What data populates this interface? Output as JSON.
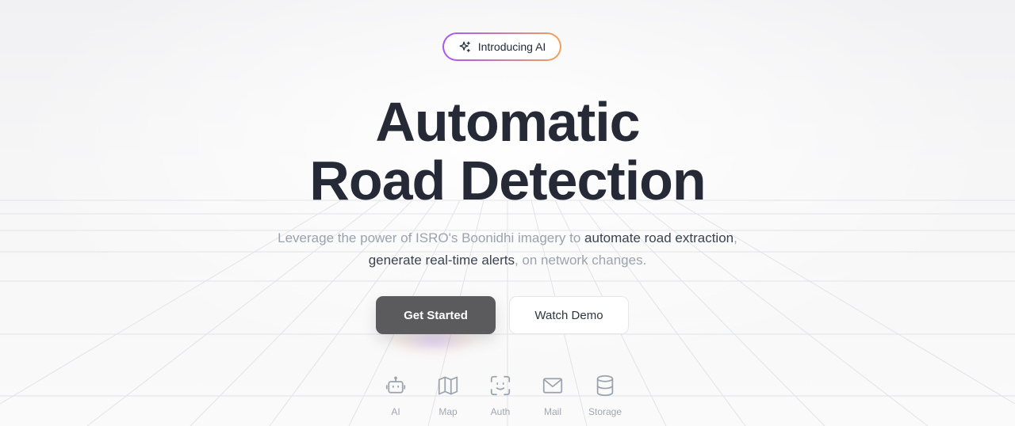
{
  "badge": {
    "icon": "sparkles-icon",
    "label": "Introducing AI",
    "gradient_from": "#a855f7",
    "gradient_to": "#f0a25a"
  },
  "hero": {
    "title_line1": "Automatic",
    "title_line2": "Road Detection",
    "subtitle": {
      "line1_pre": "Leverage the power of ISRO's Boonidhi imagery to ",
      "line1_highlight": "automate road extraction",
      "line1_post": ",",
      "line2_highlight": "generate real-time alerts",
      "line2_post": ", on network changes."
    }
  },
  "actions": {
    "primary_label": "Get Started",
    "secondary_label": "Watch Demo"
  },
  "features": [
    {
      "label": "AI",
      "icon": "robot-icon"
    },
    {
      "label": "Map",
      "icon": "map-icon"
    },
    {
      "label": "Auth",
      "icon": "face-scan-icon"
    },
    {
      "label": "Mail",
      "icon": "mail-icon"
    },
    {
      "label": "Storage",
      "icon": "database-icon"
    }
  ],
  "colors": {
    "title": "#252a36",
    "subtitle_muted": "#9aa3ae",
    "subtitle_strong": "#3b4250",
    "primary_button": "#5b5b5d",
    "icon_muted": "#9aa3ae"
  }
}
